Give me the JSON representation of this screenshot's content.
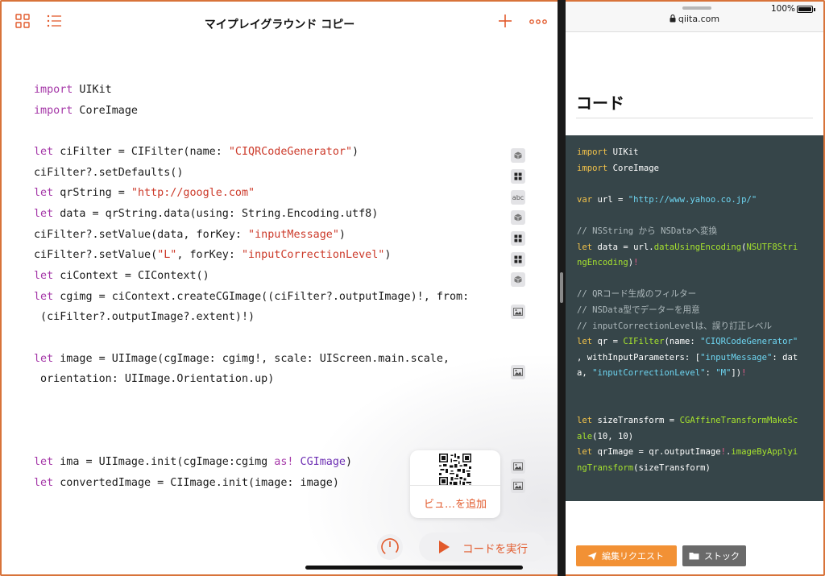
{
  "colors": {
    "accent": "#e25a2c",
    "frame": "#d8733a",
    "code_bg": "#364549",
    "edit_button": "#f29135"
  },
  "left": {
    "title": "マイプレイグラウンド コピー",
    "toolbar_icons": [
      "grid-view-icon",
      "list-view-icon",
      "plus-icon",
      "more-icon"
    ],
    "code_lines": [
      [
        [
          "kw",
          "import"
        ],
        [
          "p",
          " UIKit"
        ]
      ],
      [
        [
          "kw",
          "import"
        ],
        [
          "p",
          " CoreImage"
        ]
      ],
      [
        [
          "kw",
          "let"
        ],
        [
          "p",
          " ciFilter = CIFilter(name: "
        ],
        [
          "str",
          "\"CIQRCodeGenerator\""
        ],
        [
          "p",
          ")"
        ]
      ],
      [
        [
          "p",
          "ciFilter?.setDefaults()"
        ]
      ],
      [
        [
          "kw",
          "let"
        ],
        [
          "p",
          " qrString = "
        ],
        [
          "str",
          "\"http://google.com\""
        ]
      ],
      [
        [
          "kw",
          "let"
        ],
        [
          "p",
          " data = qrString.data(using: String.Encoding.utf8)"
        ]
      ],
      [
        [
          "p",
          "ciFilter?.setValue(data, forKey: "
        ],
        [
          "str",
          "\"inputMessage\""
        ],
        [
          "p",
          ")"
        ]
      ],
      [
        [
          "p",
          "ciFilter?.setValue("
        ],
        [
          "str",
          "\"L\""
        ],
        [
          "p",
          ", forKey: "
        ],
        [
          "str",
          "\"inputCorrectionLevel\""
        ],
        [
          "p",
          ")"
        ]
      ],
      [
        [
          "kw",
          "let"
        ],
        [
          "p",
          " ciContext = CIContext()"
        ]
      ],
      [
        [
          "kw",
          "let"
        ],
        [
          "p",
          " cgimg = ciContext.createCGImage((ciFilter?.outputImage)!, from:"
        ]
      ],
      [
        [
          "p",
          " (ciFilter?.outputImage?.extent)!)"
        ]
      ],
      [
        [
          "kw",
          "let"
        ],
        [
          "p",
          " image = UIImage(cgImage: cgimg!, scale: UIScreen.main.scale,"
        ]
      ],
      [
        [
          "p",
          " orientation: UIImage.Orientation.up)"
        ]
      ],
      [
        [
          "kw",
          "let"
        ],
        [
          "p",
          " ima = UIImage.init(cgImage:cgimg "
        ],
        [
          "kw",
          "as!"
        ],
        [
          "p",
          " "
        ],
        [
          "typ",
          "CGImage"
        ],
        [
          "p",
          ")"
        ]
      ],
      [
        [
          "kw",
          "let"
        ],
        [
          "p",
          " convertedImage = CIImage.init(image: image)"
        ]
      ]
    ],
    "results": [
      {
        "icon": "cube-icon",
        "text": ""
      },
      {
        "icon": "grid-result-icon",
        "text": ""
      },
      {
        "icon": "text-result-icon",
        "text": "abc"
      },
      {
        "icon": "cube-icon",
        "text": ""
      },
      {
        "icon": "grid-result-icon",
        "text": ""
      },
      {
        "icon": "grid-result-icon",
        "text": ""
      },
      {
        "icon": "cube-icon",
        "text": ""
      },
      {
        "icon": "image-result-icon",
        "text": ""
      },
      {
        "icon": "image-result-icon",
        "text": ""
      },
      {
        "icon": "image-result-icon",
        "text": ""
      },
      {
        "icon": "image-result-icon",
        "text": ""
      }
    ],
    "popover_label": "ビュ…を追加",
    "run_label": "コードを実行"
  },
  "right": {
    "url": "qiita.com",
    "battery": "100%",
    "heading": "コード",
    "code_lines": [
      [
        [
          "rk",
          "import"
        ],
        [
          "p",
          " UIKit"
        ]
      ],
      [
        [
          "rk",
          "import"
        ],
        [
          "p",
          " CoreImage"
        ]
      ],
      [],
      [
        [
          "rk",
          "var"
        ],
        [
          "p",
          " url = "
        ],
        [
          "rs",
          "\"http://www.yahoo.co.jp/\""
        ]
      ],
      [],
      [
        [
          "rc",
          "// NSString から NSDataへ変換"
        ]
      ],
      [
        [
          "rk",
          "let"
        ],
        [
          "p",
          " data = url."
        ],
        [
          "rf",
          "dataUsingEncoding"
        ],
        [
          "p",
          "("
        ],
        [
          "rf",
          "NSUTF8Stri"
        ]
      ],
      [
        [
          "rf",
          "ngEncoding"
        ],
        [
          "p",
          ")"
        ],
        [
          "rr",
          "!"
        ]
      ],
      [],
      [
        [
          "rc",
          "// QRコード生成のフィルター"
        ]
      ],
      [
        [
          "rc",
          "// NSData型でデーターを用意"
        ]
      ],
      [
        [
          "rc",
          "// inputCorrectionLevelは、誤り訂正レベル"
        ]
      ],
      [
        [
          "rk",
          "let"
        ],
        [
          "p",
          " qr = "
        ],
        [
          "rf",
          "CIFilter"
        ],
        [
          "p",
          "(name: "
        ],
        [
          "rs",
          "\"CIQRCodeGenerator\""
        ]
      ],
      [
        [
          "p",
          ", withInputParameters: ["
        ],
        [
          "rs",
          "\"inputMessage\""
        ],
        [
          "p",
          ": dat"
        ]
      ],
      [
        [
          "p",
          "a, "
        ],
        [
          "rs",
          "\"inputCorrectionLevel\""
        ],
        [
          "p",
          ": "
        ],
        [
          "rs",
          "\"M\""
        ],
        [
          "p",
          "])"
        ],
        [
          "rr",
          "!"
        ]
      ],
      [],
      [],
      [
        [
          "rk",
          "let"
        ],
        [
          "p",
          " sizeTransform = "
        ],
        [
          "rf",
          "CGAffineTransformMakeSc"
        ]
      ],
      [
        [
          "rf",
          "ale"
        ],
        [
          "p",
          "(10, 10)"
        ]
      ],
      [
        [
          "rk",
          "let"
        ],
        [
          "p",
          " qrImage = qr.outputImage"
        ],
        [
          "rr",
          "!"
        ],
        [
          "p",
          "."
        ],
        [
          "rf",
          "imageByApplyi"
        ]
      ],
      [
        [
          "rf",
          "ngTransform"
        ],
        [
          "p",
          "(sizeTransform)"
        ]
      ]
    ],
    "edit_label": "編集リクエスト",
    "stock_label": "ストック"
  }
}
